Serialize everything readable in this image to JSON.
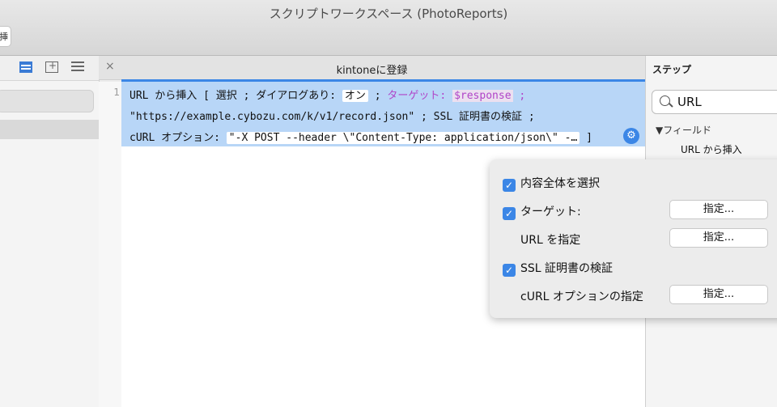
{
  "window": {
    "title": "スクリプトワークスペース (PhotoReports)",
    "toolbar_button": "挿"
  },
  "editor": {
    "tab_title": "kintoneに登録",
    "close": "×",
    "line_number": "1",
    "line1": {
      "pre": "URL から挿入 [ 選択 ; ダイアログあり: ",
      "dialog_value": "オン",
      "sep": " ; ",
      "target_label": "ターゲット: ",
      "target_value": "$response",
      "post": " ;"
    },
    "line2": "\"https://example.cybozu.com/k/v1/record.json\" ; SSL 証明書の検証 ;",
    "line3": {
      "pre": "cURL オプション: ",
      "value": "\"-X POST --header \\\"Content-Type: application/json\\\" -…",
      "post": " ]"
    }
  },
  "steps": {
    "header": "ステップ",
    "search_value": "URL",
    "tree_header": "▼フィールド",
    "tree_item": "URL から挿入"
  },
  "popover": {
    "select_all": "内容全体を選択",
    "target": "ターゲット:",
    "specify_url": "URL を指定",
    "ssl_verify": "SSL 証明書の検証",
    "curl_options": "cURL オプションの指定",
    "specify_button": "指定..."
  }
}
